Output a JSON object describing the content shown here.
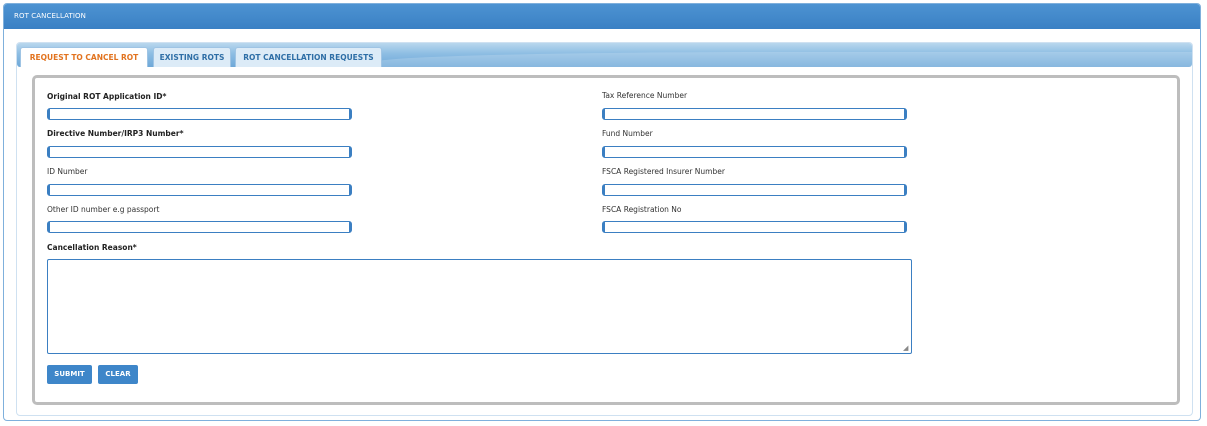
{
  "panel": {
    "title": "ROT CANCELLATION"
  },
  "tabs": [
    {
      "label": "REQUEST TO CANCEL ROT",
      "active": true
    },
    {
      "label": "EXISTING ROTS",
      "active": false
    },
    {
      "label": "ROT CANCELLATION REQUESTS",
      "active": false
    }
  ],
  "form": {
    "left": [
      {
        "label": "Original ROT Application ID*",
        "value": ""
      },
      {
        "label": "Directive Number/IRP3 Number*",
        "value": ""
      },
      {
        "label": "ID Number",
        "value": ""
      },
      {
        "label": "Other ID number e.g passport",
        "value": ""
      }
    ],
    "right": [
      {
        "label": "Tax Reference  Number",
        "value": ""
      },
      {
        "label": "Fund Number",
        "value": ""
      },
      {
        "label": "FSCA Registered Insurer Number",
        "value": ""
      },
      {
        "label": "FSCA Registration No",
        "value": ""
      }
    ],
    "reason": {
      "label": "Cancellation Reason*",
      "value": ""
    }
  },
  "buttons": {
    "submit": "SUBMIT",
    "clear": "CLEAR"
  },
  "colors": {
    "header": "#3f86c8",
    "active_tab_text": "#e2731f",
    "input_border": "#3b7fc2"
  }
}
